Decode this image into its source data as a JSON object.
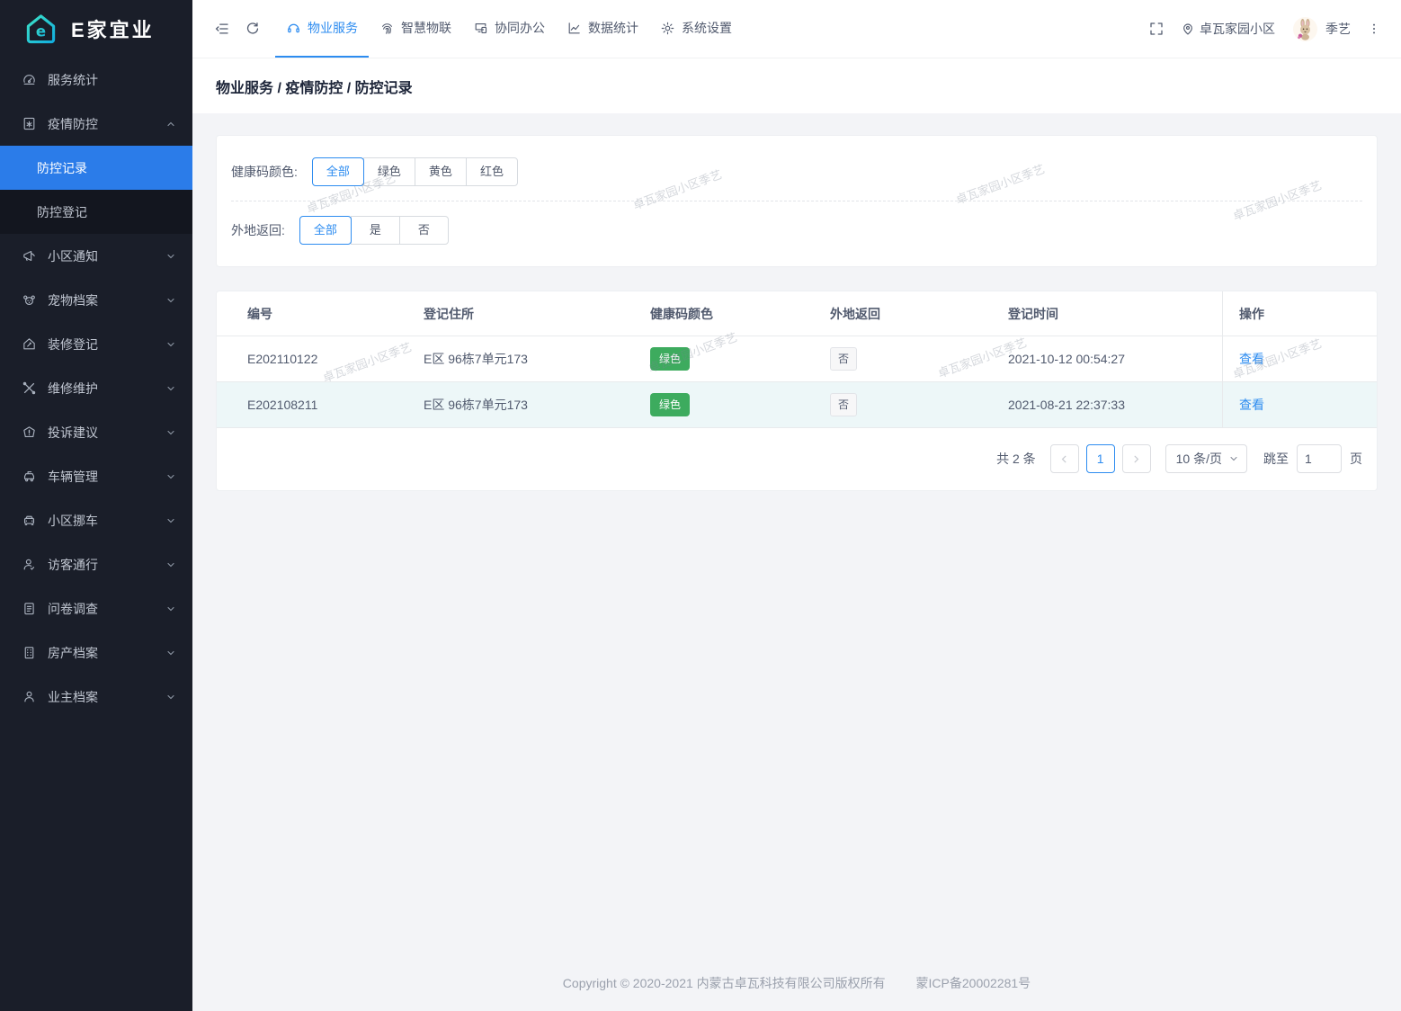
{
  "app": {
    "logo_text": "E家宜业"
  },
  "sidebar": {
    "items": [
      {
        "label": "服务统计",
        "icon": "dashboard-icon"
      },
      {
        "label": "疫情防控",
        "icon": "virus-doc-icon",
        "expanded": true
      },
      {
        "label": "小区通知",
        "icon": "megaphone-icon"
      },
      {
        "label": "宠物档案",
        "icon": "pet-icon"
      },
      {
        "label": "装修登记",
        "icon": "renovation-icon"
      },
      {
        "label": "维修维护",
        "icon": "repair-icon"
      },
      {
        "label": "投诉建议",
        "icon": "complaint-icon"
      },
      {
        "label": "车辆管理",
        "icon": "vehicle-icon"
      },
      {
        "label": "小区挪车",
        "icon": "move-car-icon"
      },
      {
        "label": "访客通行",
        "icon": "visitor-icon"
      },
      {
        "label": "问卷调查",
        "icon": "survey-icon"
      },
      {
        "label": "房产档案",
        "icon": "property-icon"
      },
      {
        "label": "业主档案",
        "icon": "owner-icon"
      }
    ],
    "epidemic_sub": [
      {
        "label": "防控记录",
        "active": true
      },
      {
        "label": "防控登记",
        "active": false
      }
    ]
  },
  "topnav": {
    "tabs": [
      {
        "label": "物业服务",
        "icon": "headset-icon",
        "active": true
      },
      {
        "label": "智慧物联",
        "icon": "fingerprint-icon",
        "active": false
      },
      {
        "label": "协同办公",
        "icon": "devices-icon",
        "active": false
      },
      {
        "label": "数据统计",
        "icon": "chart-icon",
        "active": false
      },
      {
        "label": "系统设置",
        "icon": "gear-icon",
        "active": false
      }
    ],
    "community": "卓瓦家园小区",
    "username": "季艺"
  },
  "breadcrumb": {
    "text": "物业服务 / 疫情防控 / 防控记录"
  },
  "filters": {
    "health": {
      "label": "健康码颜色:",
      "options": [
        "全部",
        "绿色",
        "黄色",
        "红色"
      ],
      "selected": "全部"
    },
    "outside": {
      "label": "外地返回:",
      "options": [
        "全部",
        "是",
        "否"
      ],
      "selected": "全部"
    }
  },
  "table": {
    "columns": [
      "编号",
      "登记住所",
      "健康码颜色",
      "外地返回",
      "登记时间",
      "操作"
    ],
    "rows": [
      {
        "id": "E202110122",
        "address": "E区 96栋7单元173",
        "health": "绿色",
        "outside": "否",
        "time": "2021-10-12 00:54:27",
        "action": "查看"
      },
      {
        "id": "E202108211",
        "address": "E区 96栋7单元173",
        "health": "绿色",
        "outside": "否",
        "time": "2021-08-21 22:37:33",
        "action": "查看"
      }
    ]
  },
  "pagination": {
    "total": "共 2 条",
    "page": "1",
    "page_size": "10 条/页",
    "jump_label": "跳至",
    "jump_value": "1",
    "jump_suffix": "页"
  },
  "footer": {
    "copyright": "Copyright © 2020-2021 内蒙古卓瓦科技有限公司版权所有",
    "icp": "蒙ICP备20002281号"
  },
  "watermark": {
    "text": "卓瓦家园小区季艺"
  },
  "colors": {
    "primary": "#2d8cf0",
    "sidebar_active": "#2b7ce9",
    "green_badge": "#3dab5e"
  }
}
